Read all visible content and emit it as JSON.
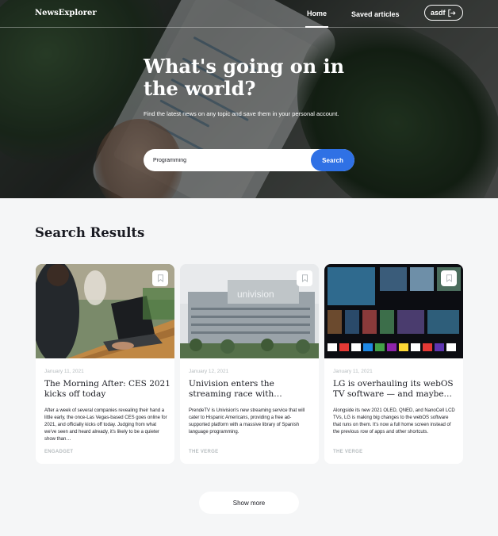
{
  "header": {
    "logo": "NewsExplorer",
    "nav_home": "Home",
    "nav_saved": "Saved articles",
    "user_name": "asdf"
  },
  "hero": {
    "title": "What's going on in the world?",
    "subtitle": "Find the latest news on any topic and save them in your personal account.",
    "search_value": "Programming",
    "search_button": "Search"
  },
  "results": {
    "title": "Search Results",
    "cards": [
      {
        "date": "January 11, 2021",
        "title": "The Morning After: CES 2021 kicks off today",
        "text": "After a week of several companies revealing their hand a little early, the once-Las Vegas-based CES goes online for 2021, and officially kicks off today. Judging from what we've seen and heard already, it's likely to be a quieter show than…",
        "source": "ENGADGET"
      },
      {
        "date": "January 12, 2021",
        "title": "Univision enters the streaming race with…",
        "text": "PrendeTV is Univision's new streaming service that will cater to Hispanic Americans, providing a free ad-supported platform with a massive library of Spanish language programming.",
        "source": "THE VERGE"
      },
      {
        "date": "January 11, 2021",
        "title": "LG is overhauling its webOS TV software — and maybe…",
        "text": "Alongside its new 2021 OLED, QNED, and NanoCell LCD TVs, LG is making big changes to the webOS software that runs on them. It's now a full home screen instead of the previous row of apps and other shortcuts.",
        "source": "THE VERGE"
      }
    ],
    "show_more": "Show more"
  },
  "colors": {
    "accent": "#2f71e5",
    "text": "#1a1b22",
    "muted": "#b6bcbf",
    "background": "#f5f6f7"
  },
  "icons": [
    "logout-icon",
    "bookmark-icon"
  ]
}
